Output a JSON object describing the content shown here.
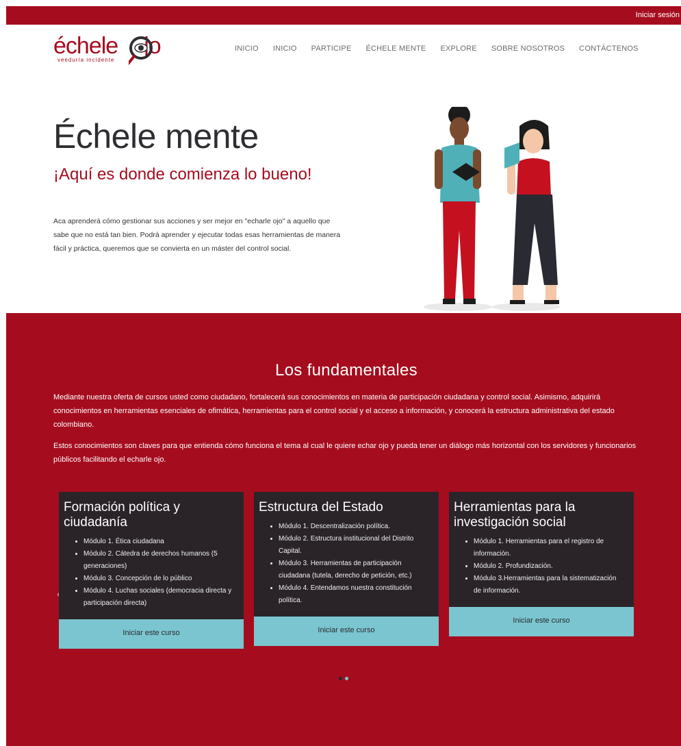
{
  "topbar": {
    "login": "Iniciar sesión"
  },
  "logo": {
    "word_left": "échele",
    "word_right": "jo",
    "subtitle": "veeduría incidente"
  },
  "nav": [
    "INICIO",
    "INICIO",
    "PARTICIPE",
    "ÉCHELE MENTE",
    "EXPLORE",
    "SOBRE NOSOTROS",
    "CONTÁCTENOS"
  ],
  "hero": {
    "title": "Échele mente",
    "subtitle": "¡Aquí es donde comienza lo bueno!",
    "paragraph": "Aca aprenderá cómo gestionar sus acciones y ser mejor en \"echarle ojo\" a aquello que sabe que no está tan bien. Podrá aprender y ejecutar todas esas herramientas de manera fácil y práctica, queremos que se convierta en un máster del control social."
  },
  "fundamentals": {
    "title": "Los fundamentales",
    "intro1": "Mediante nuestra oferta de cursos usted como ciudadano, fortalecerá sus conocimientos en materia de participación ciudadana y control social. Asimismo, adquirirá conocimientos en herramientas esenciales de ofimática, herramientas para el control social y el acceso a información, y conocerá la estructura administrativa del estado colombiano.",
    "intro2": "Estos conocimientos son claves para que entienda cómo funciona el tema al cual le quiere echar ojo y pueda tener un diálogo más horizontal con los servidores y funcionarios públicos facilitando el echarle ojo."
  },
  "courses": [
    {
      "title": "Formación política y ciudadanía",
      "modules": [
        "Módulo 1. Ética ciudadana",
        "Módulo 2. Cátedra de derechos humanos (5 generaciones)",
        "Módulo 3. Concepción de lo público",
        "Módulo 4. Luchas sociales (democracia directa y participación directa)"
      ],
      "button": "Iniciar este curso"
    },
    {
      "title": "Estructura del Estado",
      "modules": [
        "Módulo 1. Descentralización política.",
        "Módulo 2. Estructura institucional del Distrito Capital.",
        "Módulo 3. Herramientas de participación ciudadana (tutela, derecho de petición, etc.)",
        "Módulo 4. Entendamos nuestra constitución política."
      ],
      "button": "Iniciar este curso"
    },
    {
      "title": "Herramientas para la investigación social",
      "modules": [
        "Módulo 1. Herramientas para el registro de información.",
        "Módulo 2. Profundización.",
        "Módulo 3.Herramientas para la sistematización de información."
      ],
      "button": "Iniciar este curso"
    }
  ],
  "carousel": {
    "prev": "‹",
    "next": "›",
    "active_index": 0
  },
  "colors": {
    "brand": "#a50d1f",
    "card": "#2a2428",
    "button": "#7ac5d0"
  }
}
